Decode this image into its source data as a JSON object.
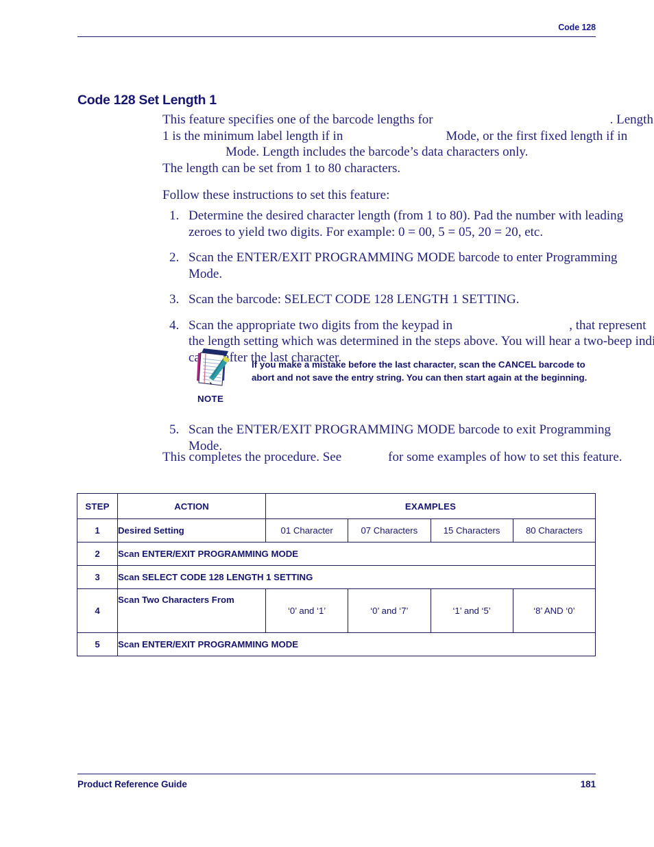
{
  "header": {
    "running_head": "Code 128"
  },
  "section": {
    "title": "Code 128 Set Length 1"
  },
  "intro": {
    "line1_a": "This feature specifies one of the barcode lengths for",
    "line1_b": ". Length",
    "line2_a": "1 is the minimum label length if in",
    "line2_b": "Mode, or the first fixed length if in",
    "line3_a": "Mode. Length includes the barcode’s data characters only.",
    "line4": "The length can be set from 1 to 80 characters."
  },
  "follow_line": "Follow these instructions to set this feature:",
  "steps": [
    {
      "num": "1.",
      "lines": [
        "Determine the desired character length (from 1 to 80). Pad the number with leading",
        "zeroes to yield two digits. For example: 0 = 00, 5 = 05, 20 = 20, etc."
      ]
    },
    {
      "num": "2.",
      "lines": [
        "Scan the ENTER/EXIT PROGRAMMING MODE barcode to enter Programming",
        "Mode."
      ]
    },
    {
      "num": "3.",
      "lines": [
        "Scan the barcode: SELECT CODE 128 LENGTH 1 SETTING."
      ]
    },
    {
      "num": "4.",
      "line1_a": "Scan the appropriate two digits from the keypad in",
      "line1_b": ", that represent",
      "line2": "the length setting which was determined in the steps above. You will hear a two-beep indi-",
      "line3": "cation after the last character."
    }
  ],
  "note": {
    "icon": "notepad-pencil-icon",
    "line1": "If you make a mistake before the last character, scan the CANCEL barcode to",
    "line2": "abort and not save the entry string. You can then start again at the beginning.",
    "label": "NOTE"
  },
  "step5": {
    "num": "5.",
    "line1": "Scan the ENTER/EXIT PROGRAMMING MODE barcode to exit Programming",
    "line2": "Mode."
  },
  "closing": {
    "part_a": "This completes the procedure. See",
    "part_b": "for some examples of how to set this feature."
  },
  "table": {
    "headers": {
      "step": "STEP",
      "action": "ACTION",
      "examples": "EXAMPLES"
    },
    "rows": [
      {
        "step": "1",
        "action": "Desired Setting",
        "examples": [
          "01 Character",
          "07 Characters",
          "15 Characters",
          "80 Characters"
        ]
      },
      {
        "step": "2",
        "action": "Scan ENTER/EXIT PROGRAMMING MODE",
        "examples": []
      },
      {
        "step": "3",
        "action": "Scan SELECT CODE 128 LENGTH 1 SETTING",
        "examples": []
      },
      {
        "step": "4",
        "action": "Scan Two Characters From",
        "examples": [
          "‘0’ and ‘1’",
          "‘0’ and ‘7’",
          "‘1’ and ‘5’",
          "‘8’ AND ‘0’"
        ]
      },
      {
        "step": "5",
        "action": "Scan ENTER/EXIT PROGRAMMING MODE",
        "examples": []
      }
    ]
  },
  "footer": {
    "guide_title": "Product Reference Guide",
    "page_number": "181"
  },
  "colors": {
    "navy": "#1a1a7a",
    "text_blue": "#23237e",
    "rule": "#1a1a70"
  }
}
